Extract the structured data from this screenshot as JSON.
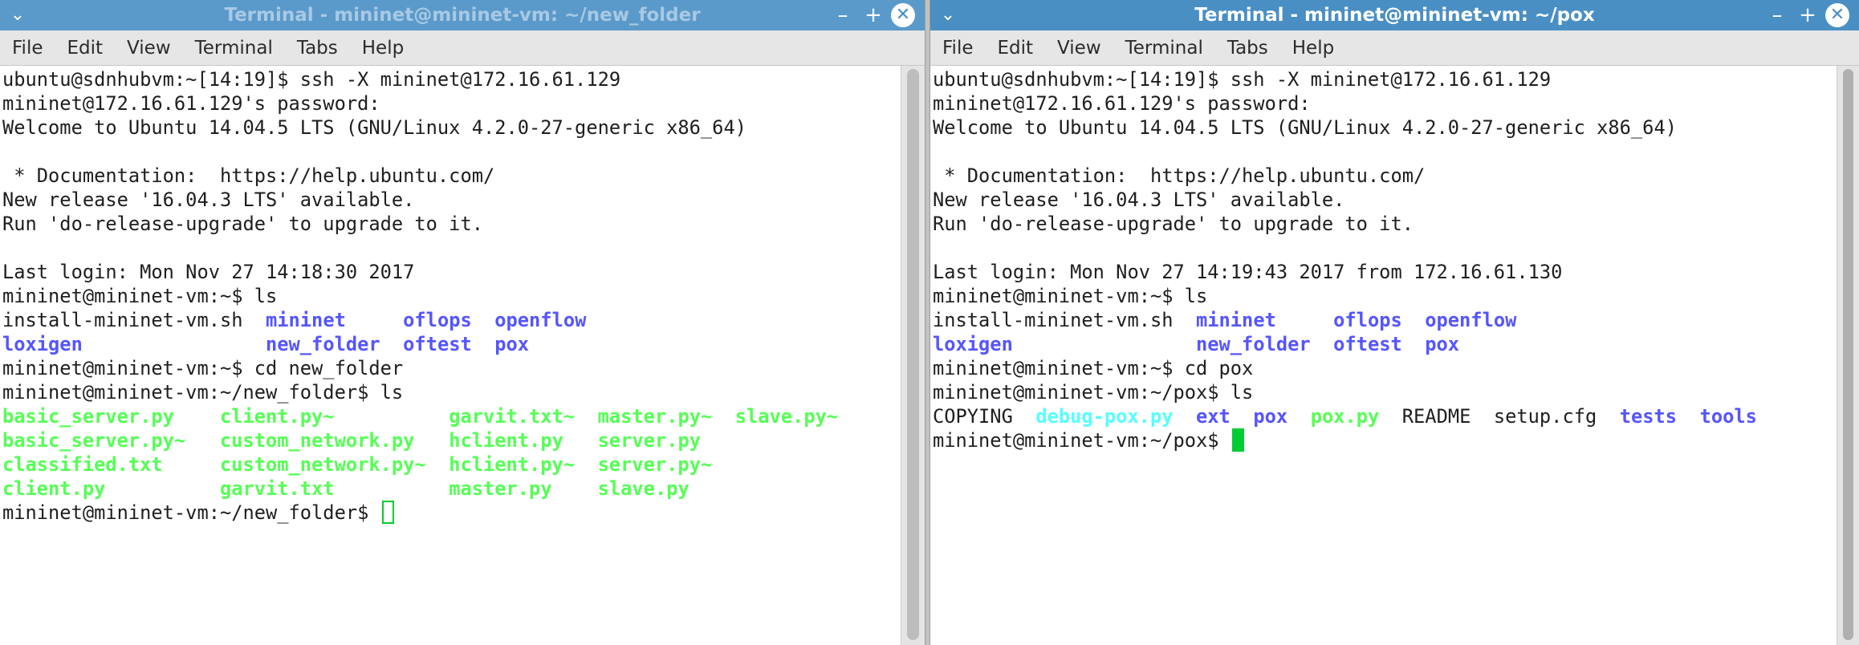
{
  "windows": [
    {
      "title": "Terminal - mininet@mininet-vm: ~/new_folder",
      "menu": [
        "File",
        "Edit",
        "View",
        "Terminal",
        "Tabs",
        "Help"
      ],
      "lines": [
        [
          {
            "t": "ubuntu@sdnhubvm:~[14:19]$ ssh -X mininet@172.16.61.129",
            "c": "plain"
          }
        ],
        [
          {
            "t": "mininet@172.16.61.129's password:",
            "c": "plain"
          }
        ],
        [
          {
            "t": "Welcome to Ubuntu 14.04.5 LTS (GNU/Linux 4.2.0-27-generic x86_64)",
            "c": "plain"
          }
        ],
        [],
        [
          {
            "t": " * Documentation:  https://help.ubuntu.com/",
            "c": "plain"
          }
        ],
        [
          {
            "t": "New release '16.04.3 LTS' available.",
            "c": "plain"
          }
        ],
        [
          {
            "t": "Run 'do-release-upgrade' to upgrade to it.",
            "c": "plain"
          }
        ],
        [],
        [
          {
            "t": "Last login: Mon Nov 27 14:18:30 2017",
            "c": "plain"
          }
        ],
        [
          {
            "t": "mininet@mininet-vm:~$ ls",
            "c": "plain"
          }
        ],
        [
          {
            "t": "install-mininet-vm.sh  ",
            "c": "plain"
          },
          {
            "t": "mininet",
            "c": "blue"
          },
          {
            "t": "     ",
            "c": "plain"
          },
          {
            "t": "oflops",
            "c": "blue"
          },
          {
            "t": "  ",
            "c": "plain"
          },
          {
            "t": "openflow",
            "c": "blue"
          }
        ],
        [
          {
            "t": "loxigen",
            "c": "blue"
          },
          {
            "t": "                ",
            "c": "plain"
          },
          {
            "t": "new_folder",
            "c": "blue"
          },
          {
            "t": "  ",
            "c": "plain"
          },
          {
            "t": "oftest",
            "c": "blue"
          },
          {
            "t": "  ",
            "c": "plain"
          },
          {
            "t": "pox",
            "c": "blue"
          }
        ],
        [
          {
            "t": "mininet@mininet-vm:~$ cd new_folder",
            "c": "plain"
          }
        ],
        [
          {
            "t": "mininet@mininet-vm:~/new_folder$ ls",
            "c": "plain"
          }
        ],
        [
          {
            "t": "basic_server.py",
            "c": "green"
          },
          {
            "t": "    ",
            "c": "plain"
          },
          {
            "t": "client.py~",
            "c": "green"
          },
          {
            "t": "          ",
            "c": "plain"
          },
          {
            "t": "garvit.txt~",
            "c": "green"
          },
          {
            "t": "  ",
            "c": "plain"
          },
          {
            "t": "master.py~",
            "c": "green"
          },
          {
            "t": "  ",
            "c": "plain"
          },
          {
            "t": "slave.py~",
            "c": "green"
          }
        ],
        [
          {
            "t": "basic_server.py~",
            "c": "green"
          },
          {
            "t": "   ",
            "c": "plain"
          },
          {
            "t": "custom_network.py",
            "c": "green"
          },
          {
            "t": "   ",
            "c": "plain"
          },
          {
            "t": "hclient.py",
            "c": "green"
          },
          {
            "t": "   ",
            "c": "plain"
          },
          {
            "t": "server.py",
            "c": "green"
          }
        ],
        [
          {
            "t": "classified.txt",
            "c": "green"
          },
          {
            "t": "     ",
            "c": "plain"
          },
          {
            "t": "custom_network.py~",
            "c": "green"
          },
          {
            "t": "  ",
            "c": "plain"
          },
          {
            "t": "hclient.py~",
            "c": "green"
          },
          {
            "t": "  ",
            "c": "plain"
          },
          {
            "t": "server.py~",
            "c": "green"
          }
        ],
        [
          {
            "t": "client.py",
            "c": "green"
          },
          {
            "t": "          ",
            "c": "plain"
          },
          {
            "t": "garvit.txt",
            "c": "green"
          },
          {
            "t": "          ",
            "c": "plain"
          },
          {
            "t": "master.py",
            "c": "green"
          },
          {
            "t": "    ",
            "c": "plain"
          },
          {
            "t": "slave.py",
            "c": "green"
          }
        ],
        [
          {
            "t": "mininet@mininet-vm:~/new_folder$ ",
            "c": "plain"
          }
        ]
      ]
    },
    {
      "title": "Terminal - mininet@mininet-vm: ~/pox",
      "menu": [
        "File",
        "Edit",
        "View",
        "Terminal",
        "Tabs",
        "Help"
      ],
      "lines": [
        [
          {
            "t": "ubuntu@sdnhubvm:~[14:19]$ ssh -X mininet@172.16.61.129",
            "c": "plain"
          }
        ],
        [
          {
            "t": "mininet@172.16.61.129's password:",
            "c": "plain"
          }
        ],
        [
          {
            "t": "Welcome to Ubuntu 14.04.5 LTS (GNU/Linux 4.2.0-27-generic x86_64)",
            "c": "plain"
          }
        ],
        [],
        [
          {
            "t": " * Documentation:  https://help.ubuntu.com/",
            "c": "plain"
          }
        ],
        [
          {
            "t": "New release '16.04.3 LTS' available.",
            "c": "plain"
          }
        ],
        [
          {
            "t": "Run 'do-release-upgrade' to upgrade to it.",
            "c": "plain"
          }
        ],
        [],
        [
          {
            "t": "Last login: Mon Nov 27 14:19:43 2017 from 172.16.61.130",
            "c": "plain"
          }
        ],
        [
          {
            "t": "mininet@mininet-vm:~$ ls",
            "c": "plain"
          }
        ],
        [
          {
            "t": "install-mininet-vm.sh  ",
            "c": "plain"
          },
          {
            "t": "mininet",
            "c": "blue"
          },
          {
            "t": "     ",
            "c": "plain"
          },
          {
            "t": "oflops",
            "c": "blue"
          },
          {
            "t": "  ",
            "c": "plain"
          },
          {
            "t": "openflow",
            "c": "blue"
          }
        ],
        [
          {
            "t": "loxigen",
            "c": "blue"
          },
          {
            "t": "                ",
            "c": "plain"
          },
          {
            "t": "new_folder",
            "c": "blue"
          },
          {
            "t": "  ",
            "c": "plain"
          },
          {
            "t": "oftest",
            "c": "blue"
          },
          {
            "t": "  ",
            "c": "plain"
          },
          {
            "t": "pox",
            "c": "blue"
          }
        ],
        [
          {
            "t": "mininet@mininet-vm:~$ cd pox",
            "c": "plain"
          }
        ],
        [
          {
            "t": "mininet@mininet-vm:~/pox$ ls",
            "c": "plain"
          }
        ],
        [
          {
            "t": "COPYING  ",
            "c": "plain"
          },
          {
            "t": "debug-pox.py",
            "c": "cyan"
          },
          {
            "t": "  ",
            "c": "plain"
          },
          {
            "t": "ext",
            "c": "blue"
          },
          {
            "t": "  ",
            "c": "plain"
          },
          {
            "t": "pox",
            "c": "blue"
          },
          {
            "t": "  ",
            "c": "plain"
          },
          {
            "t": "pox.py",
            "c": "green"
          },
          {
            "t": "  README  setup.cfg  ",
            "c": "plain"
          },
          {
            "t": "tests",
            "c": "blue"
          },
          {
            "t": "  ",
            "c": "plain"
          },
          {
            "t": "tools",
            "c": "blue"
          }
        ],
        [
          {
            "t": "mininet@mininet-vm:~/pox$ ",
            "c": "plain"
          }
        ]
      ]
    }
  ],
  "icons": {
    "window_menu": "chevron-down-icon",
    "minimize": "minimize-icon",
    "maximize": "maximize-icon",
    "close": "close-icon"
  },
  "colors": {
    "titlebar": "#4a8fc4",
    "directory": "#5555ff",
    "executable": "#55ff55",
    "symlink": "#55ffff",
    "cursor": "#00cc33"
  }
}
